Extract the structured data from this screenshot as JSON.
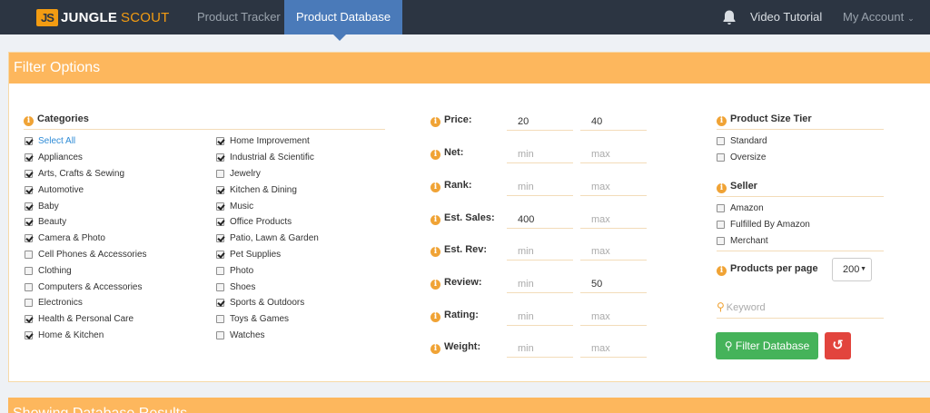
{
  "nav": {
    "logo_mark": "JS",
    "logo_text": "JUNGLE",
    "logo_accent": "SCOUT",
    "product_tracker": "Product Tracker",
    "product_database": "Product Database",
    "video_tutorial": "Video Tutorial",
    "my_account": "My Account"
  },
  "filter": {
    "title": "Filter Options",
    "categories_title": "Categories",
    "categories_col1": [
      {
        "label": "Select All",
        "checked": true,
        "link": true
      },
      {
        "label": "Appliances",
        "checked": true
      },
      {
        "label": "Arts, Crafts & Sewing",
        "checked": true
      },
      {
        "label": "Automotive",
        "checked": true
      },
      {
        "label": "Baby",
        "checked": true
      },
      {
        "label": "Beauty",
        "checked": true
      },
      {
        "label": "Camera & Photo",
        "checked": true
      },
      {
        "label": "Cell Phones & Accessories",
        "checked": false
      },
      {
        "label": "Clothing",
        "checked": false
      },
      {
        "label": "Computers & Accessories",
        "checked": false
      },
      {
        "label": "Electronics",
        "checked": false
      },
      {
        "label": "Health & Personal Care",
        "checked": true
      },
      {
        "label": "Home & Kitchen",
        "checked": true
      }
    ],
    "categories_col2": [
      {
        "label": "Home Improvement",
        "checked": true
      },
      {
        "label": "Industrial & Scientific",
        "checked": true
      },
      {
        "label": "Jewelry",
        "checked": false
      },
      {
        "label": "Kitchen & Dining",
        "checked": true
      },
      {
        "label": "Music",
        "checked": true
      },
      {
        "label": "Office Products",
        "checked": true
      },
      {
        "label": "Patio, Lawn & Garden",
        "checked": true
      },
      {
        "label": "Pet Supplies",
        "checked": true
      },
      {
        "label": "Photo",
        "checked": false
      },
      {
        "label": "Shoes",
        "checked": false
      },
      {
        "label": "Sports & Outdoors",
        "checked": true
      },
      {
        "label": "Toys & Games",
        "checked": false
      },
      {
        "label": "Watches",
        "checked": false
      }
    ],
    "ranges": [
      {
        "label": "Price:",
        "min_value": "20",
        "max_value": "40"
      },
      {
        "label": "Net:",
        "min_value": "",
        "max_value": ""
      },
      {
        "label": "Rank:",
        "min_value": "",
        "max_value": ""
      },
      {
        "label": "Est. Sales:",
        "min_value": "400",
        "max_value": ""
      },
      {
        "label": "Est. Rev:",
        "min_value": "",
        "max_value": ""
      },
      {
        "label": "Review:",
        "min_value": "",
        "max_value": "50"
      },
      {
        "label": "Rating:",
        "min_value": "",
        "max_value": ""
      },
      {
        "label": "Weight:",
        "min_value": "",
        "max_value": ""
      }
    ],
    "min_placeholder": "min",
    "max_placeholder": "max",
    "size_tier_title": "Product Size Tier",
    "size_tiers": [
      {
        "label": "Standard",
        "checked": false
      },
      {
        "label": "Oversize",
        "checked": false
      }
    ],
    "seller_title": "Seller",
    "sellers": [
      {
        "label": "Amazon",
        "checked": false
      },
      {
        "label": "Fulfilled By Amazon",
        "checked": false
      },
      {
        "label": "Merchant",
        "checked": false
      }
    ],
    "per_page_label": "Products per page",
    "per_page_value": "200",
    "keyword_placeholder": "Keyword",
    "filter_button": "Filter Database"
  },
  "results": {
    "title": "Showing Database Results"
  },
  "colors": {
    "navbar": "#2c3542",
    "nav_active": "#4a7ab9",
    "panel_header": "#fdb75d",
    "info_icon": "#f0a335",
    "filter_button": "#45b35a",
    "reset_button": "#e2443d",
    "link": "#2e8bd6"
  }
}
